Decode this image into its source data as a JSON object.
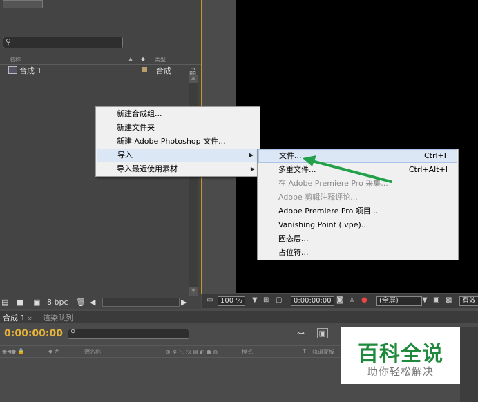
{
  "project": {
    "search_icon": "search-icon",
    "col_name": "名称",
    "col_type": "类型",
    "items": [
      {
        "name": "合成 1",
        "type": "合成"
      }
    ],
    "footer_bpc": "8 bpc"
  },
  "context_menu": {
    "items": [
      {
        "label": "新建合成组..."
      },
      {
        "label": "新建文件夹"
      },
      {
        "label": "新建 Adobe Photoshop 文件..."
      },
      {
        "label": "导入",
        "submenu": true,
        "highlighted": true
      },
      {
        "label": "导入最近使用素材",
        "submenu": true
      }
    ]
  },
  "import_submenu": {
    "items": [
      {
        "label": "文件...",
        "shortcut": "Ctrl+I",
        "highlighted": true
      },
      {
        "label": "多重文件...",
        "shortcut": "Ctrl+Alt+I"
      },
      {
        "label": "在 Adobe Premiere Pro 采集...",
        "disabled": true
      },
      {
        "label": "Adobe 剪辑注释评论...",
        "disabled": true
      },
      {
        "label": "Adobe Premiere Pro 项目..."
      },
      {
        "label": "Vanishing Point (.vpe)..."
      },
      {
        "label": "固态层..."
      },
      {
        "label": "占位符..."
      }
    ]
  },
  "viewer": {
    "zoom": "100 %",
    "timecode": "0:00:00:00",
    "resolution": "(全屏)",
    "right_cut": "有效"
  },
  "timeline": {
    "tab_comp": "合成 1",
    "tab_render": "渲染队列",
    "timecode": "0:00:00:00",
    "col_source": "源名称",
    "col_mode": "模式",
    "col_t": "T",
    "col_track": "轨道蒙板"
  },
  "watermark": {
    "title": "百科全说",
    "subtitle": "助你轻松解决"
  },
  "colors": {
    "panel_bg": "#444444",
    "accent_orange": "#c79a26",
    "timecode_gold": "#e6b33a",
    "menu_bg": "#f0f0f0",
    "menu_highlight": "#dce7f5",
    "arrow_green": "#22a14a",
    "watermark_green": "#1f8a3e"
  }
}
